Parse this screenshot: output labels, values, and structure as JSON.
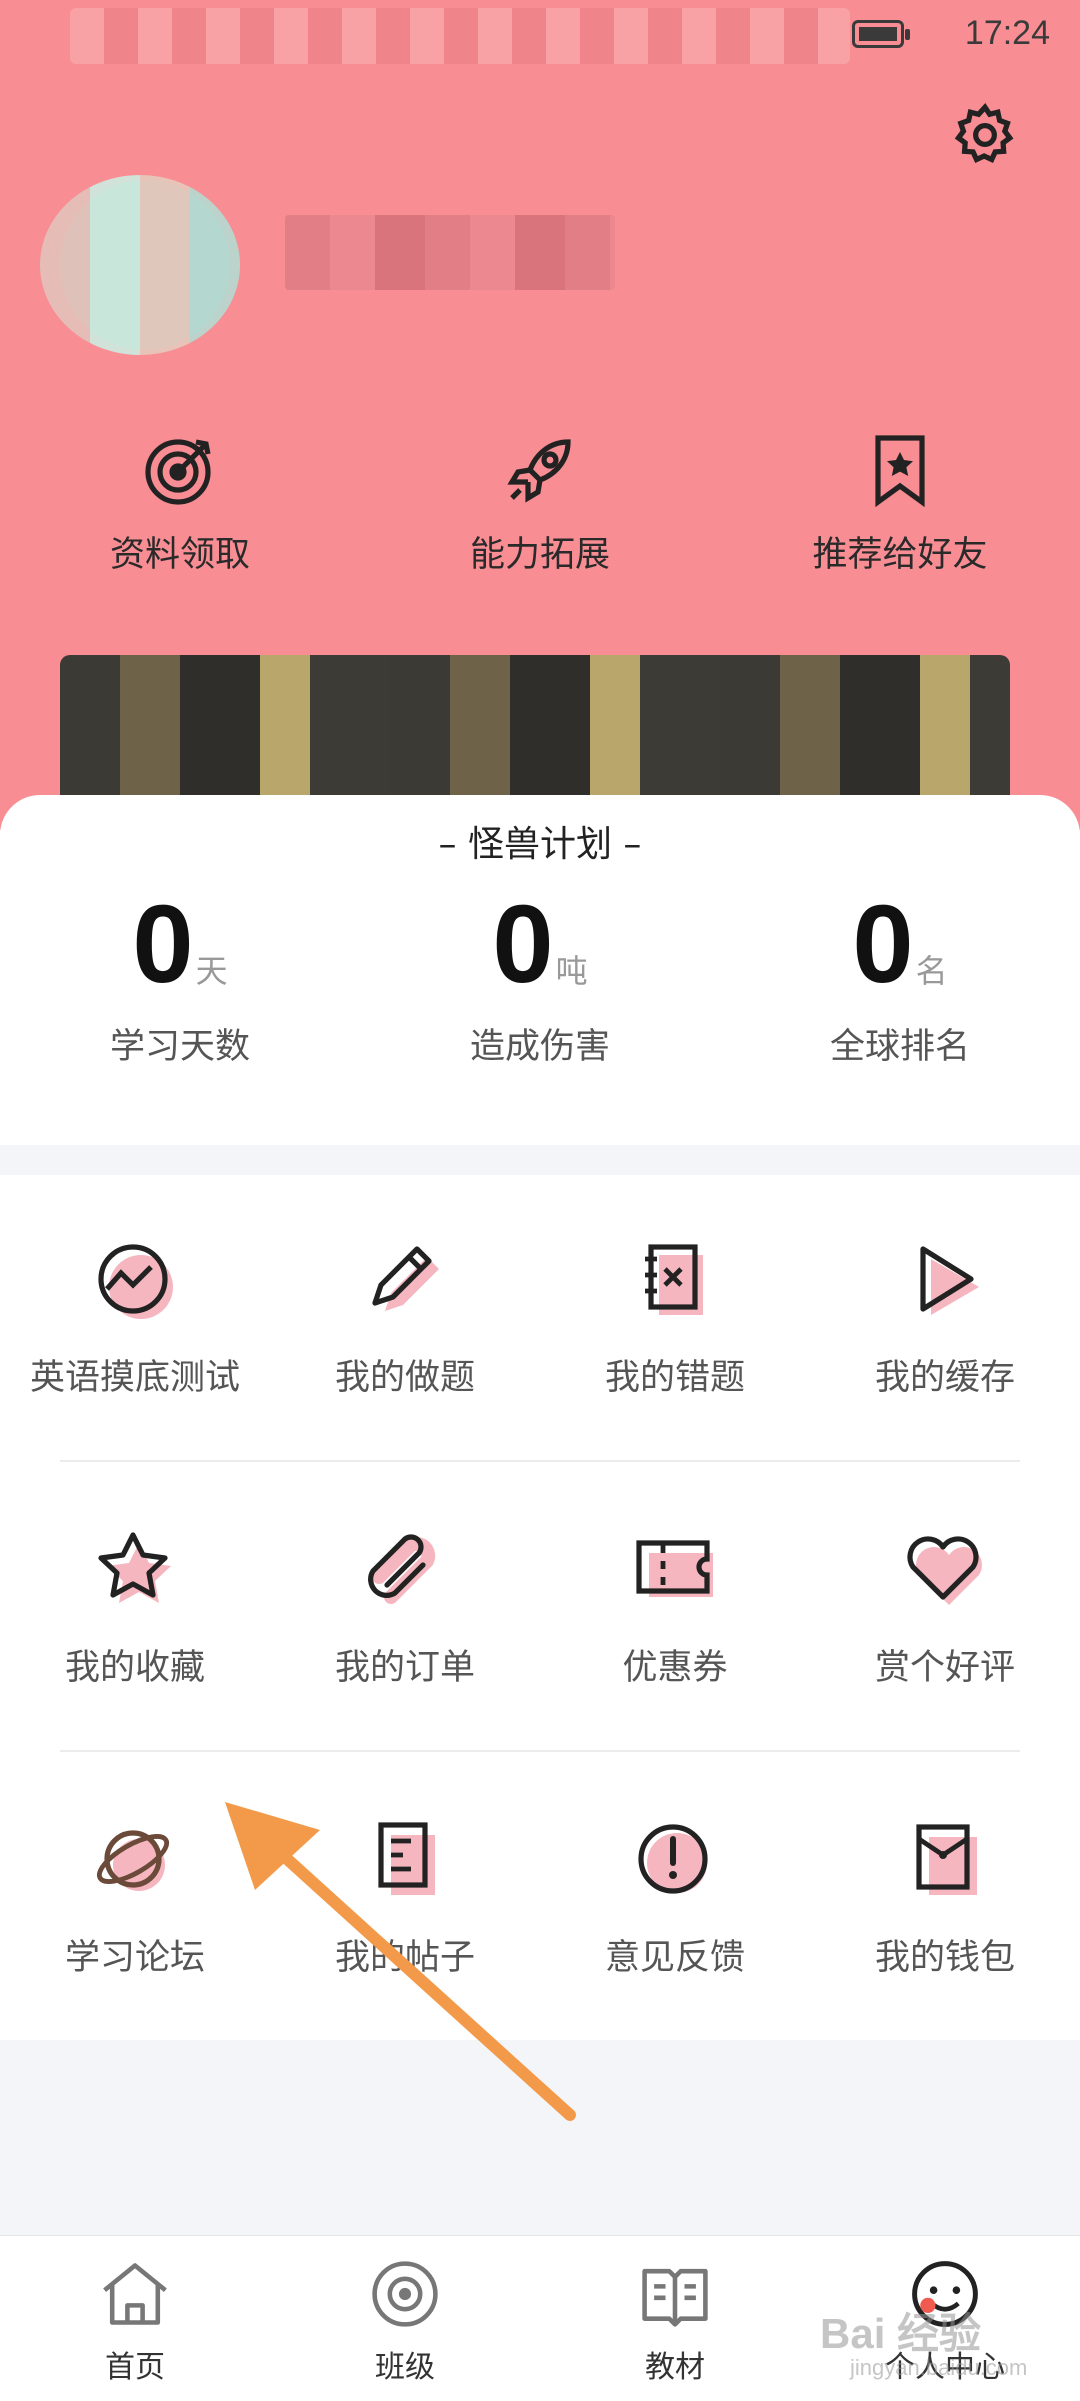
{
  "status_bar": {
    "time": "17:24"
  },
  "quick_actions": [
    {
      "label": "资料领取",
      "icon": "target-icon"
    },
    {
      "label": "能力拓展",
      "icon": "rocket-icon"
    },
    {
      "label": "推荐给好友",
      "icon": "bookmark-star-icon"
    }
  ],
  "plan": {
    "title": "– 怪兽计划 –",
    "stats": [
      {
        "value": "0",
        "unit": "天",
        "label": "学习天数"
      },
      {
        "value": "0",
        "unit": "吨",
        "label": "造成伤害"
      },
      {
        "value": "0",
        "unit": "名",
        "label": "全球排名"
      }
    ]
  },
  "menu": {
    "row1": [
      {
        "label": "英语摸底测试",
        "icon": "trend-chart-icon"
      },
      {
        "label": "我的做题",
        "icon": "pencil-icon"
      },
      {
        "label": "我的错题",
        "icon": "wrong-notebook-icon"
      },
      {
        "label": "我的缓存",
        "icon": "play-icon"
      }
    ],
    "row2": [
      {
        "label": "我的收藏",
        "icon": "star-icon"
      },
      {
        "label": "我的订单",
        "icon": "paperclip-icon"
      },
      {
        "label": "优惠券",
        "icon": "coupon-icon"
      },
      {
        "label": "赏个好评",
        "icon": "heart-icon"
      }
    ],
    "row3": [
      {
        "label": "学习论坛",
        "icon": "planet-icon"
      },
      {
        "label": "我的帖子",
        "icon": "document-icon"
      },
      {
        "label": "意见反馈",
        "icon": "exclamation-icon"
      },
      {
        "label": "我的钱包",
        "icon": "wallet-icon"
      }
    ]
  },
  "tabbar": [
    {
      "label": "首页",
      "icon": "home-icon"
    },
    {
      "label": "班级",
      "icon": "class-icon"
    },
    {
      "label": "教材",
      "icon": "book-icon"
    },
    {
      "label": "个人中心",
      "icon": "profile-face-icon"
    }
  ],
  "watermark": {
    "brand": "Bai 经验",
    "url": "jingyan.baidu.com"
  },
  "colors": {
    "header": "#f88d93",
    "accent_pink": "#f6b6bf",
    "arrow": "#f39a4a"
  }
}
